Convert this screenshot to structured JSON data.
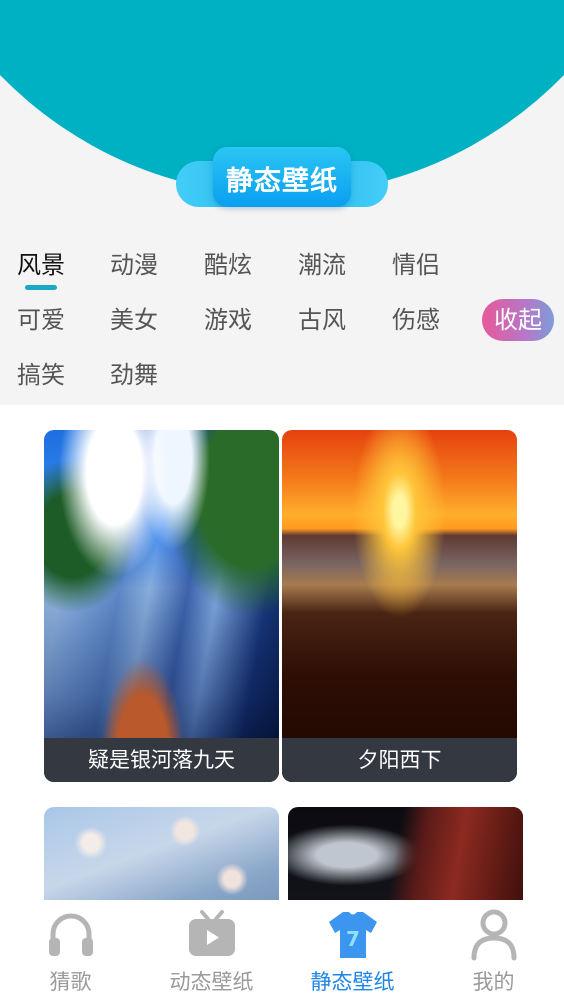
{
  "header": {
    "title": "静态壁纸"
  },
  "categories": {
    "items": [
      "风景",
      "动漫",
      "酷炫",
      "潮流",
      "情侣",
      "可爱",
      "美女",
      "游戏",
      "古风",
      "伤感",
      "搞笑",
      "劲舞"
    ],
    "active": "风景",
    "collapse_label": "收起"
  },
  "wallpapers": [
    {
      "title": "疑是银河落九天",
      "image": "waterfall"
    },
    {
      "title": "夕阳西下",
      "image": "sunset"
    },
    {
      "title": "",
      "image": "cherry-blossom"
    },
    {
      "title": "",
      "image": "night-building"
    }
  ],
  "bottom_nav": {
    "items": [
      {
        "label": "猜歌",
        "icon": "headphones-icon"
      },
      {
        "label": "动态壁纸",
        "icon": "tv-play-icon"
      },
      {
        "label": "静态壁纸",
        "icon": "tshirt-icon"
      },
      {
        "label": "我的",
        "icon": "person-icon"
      }
    ],
    "active": "静态壁纸"
  },
  "colors": {
    "header": "#00b0c3",
    "accent": "#1f86e8",
    "underline": "#19a9c4"
  }
}
